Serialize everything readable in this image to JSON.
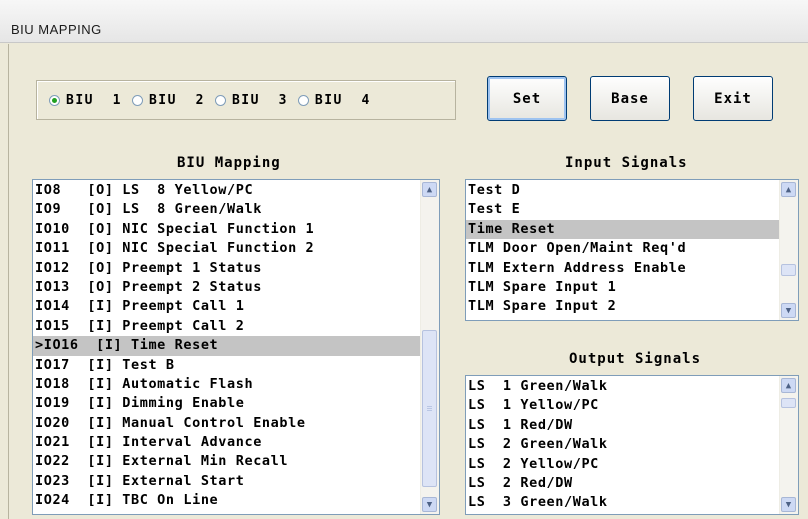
{
  "window": {
    "title": "BIU MAPPING"
  },
  "biu_selector": {
    "options": [
      {
        "label": "BIU  1",
        "checked": true
      },
      {
        "label": "BIU  2",
        "checked": false
      },
      {
        "label": "BIU  3",
        "checked": false
      },
      {
        "label": "BIU  4",
        "checked": false
      }
    ]
  },
  "buttons": {
    "set": "Set",
    "base": "Base",
    "exit": "Exit"
  },
  "biu_mapping": {
    "title": "BIU Mapping",
    "items": [
      "IO8   [O] LS  8 Yellow/PC",
      "IO9   [O] LS  8 Green/Walk",
      "IO10  [O] NIC Special Function 1",
      "IO11  [O] NIC Special Function 2",
      "IO12  [O] Preempt 1 Status",
      "IO13  [O] Preempt 2 Status",
      "IO14  [I] Preempt Call 1",
      "IO15  [I] Preempt Call 2",
      ">IO16  [I] Time Reset",
      "IO17  [I] Test B",
      "IO18  [I] Automatic Flash",
      "IO19  [I] Dimming Enable",
      "IO20  [I] Manual Control Enable",
      "IO21  [I] Interval Advance",
      "IO22  [I] External Min Recall",
      "IO23  [I] External Start",
      "IO24  [I] TBC On Line"
    ],
    "selected_index": 8
  },
  "input_signals": {
    "title": "Input Signals",
    "items": [
      "Test D",
      "Test E",
      "Time Reset",
      "TLM Door Open/Maint Req'd",
      "TLM Extern Address Enable",
      "TLM Spare Input 1",
      "TLM Spare Input 2"
    ],
    "selected_index": 2
  },
  "output_signals": {
    "title": "Output Signals",
    "items": [
      "LS  1 Green/Walk",
      "LS  1 Yellow/PC",
      "LS  1 Red/DW",
      "LS  2 Green/Walk",
      "LS  2 Yellow/PC",
      "LS  2 Red/DW",
      "LS  3 Green/Walk"
    ]
  }
}
